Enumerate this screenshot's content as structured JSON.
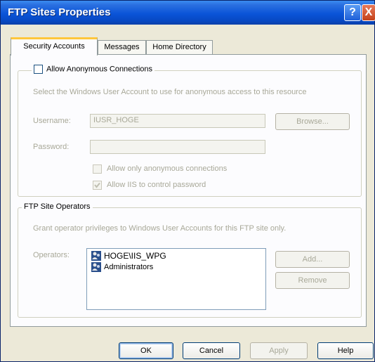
{
  "window": {
    "title": "FTP Sites Properties",
    "help_glyph": "?",
    "close_glyph": "X"
  },
  "tabs": [
    {
      "label": "Security Accounts",
      "active": true
    },
    {
      "label": "Messages",
      "active": false
    },
    {
      "label": "Home Directory",
      "active": false
    }
  ],
  "anonymous": {
    "checkbox_label": "Allow Anonymous Connections",
    "checked": false,
    "description": "Select the Windows User Account to use for anonymous access to this resource",
    "username_label": "Username:",
    "username_value": "IUSR_HOGE",
    "password_label": "Password:",
    "password_value": "",
    "browse_label": "Browse...",
    "allow_only_anonymous_label": "Allow only anonymous connections",
    "allow_only_anonymous_checked": false,
    "allow_iis_label": "Allow IIS to control password",
    "allow_iis_checked": true
  },
  "operators": {
    "group_title": "FTP Site Operators",
    "description": "Grant operator privileges to Windows User Accounts for this FTP site only.",
    "label": "Operators:",
    "items": [
      {
        "name": "HOGE\\IIS_WPG",
        "icon": "user-group-icon"
      },
      {
        "name": "Administrators",
        "icon": "user-group-icon"
      }
    ],
    "add_label": "Add...",
    "remove_label": "Remove"
  },
  "footer": {
    "ok_label": "OK",
    "cancel_label": "Cancel",
    "apply_label": "Apply",
    "help_label": "Help"
  }
}
